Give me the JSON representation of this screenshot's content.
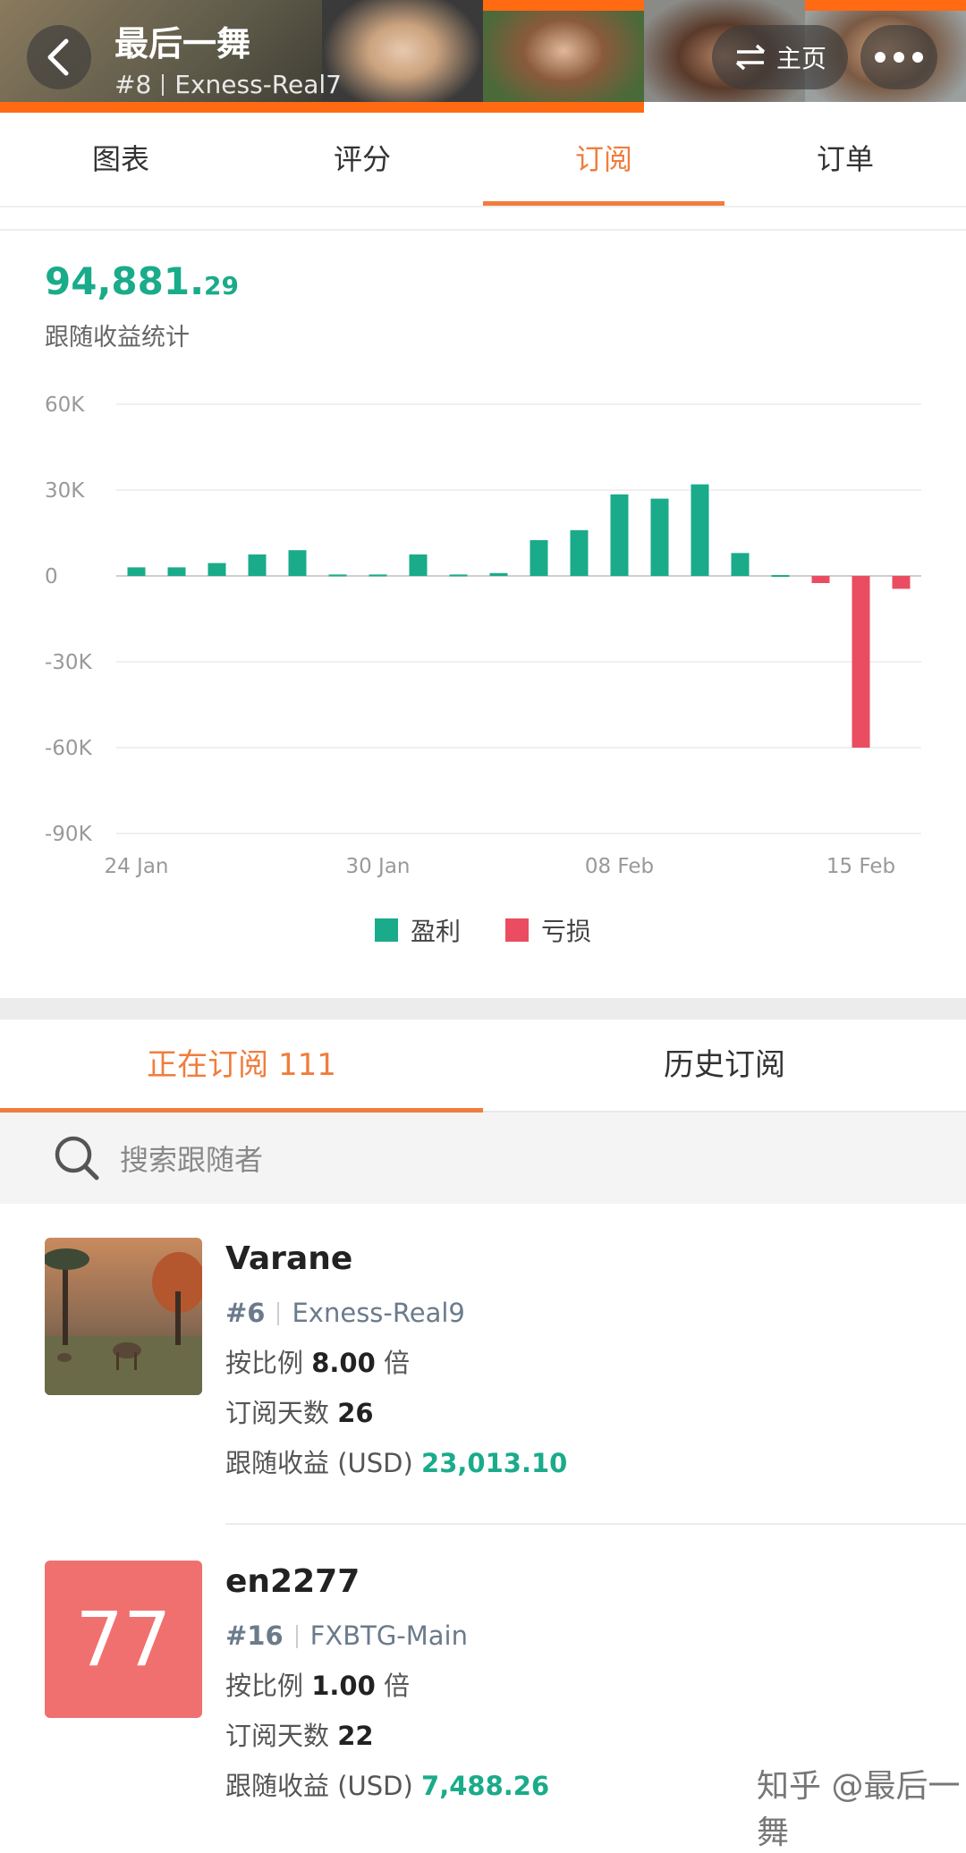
{
  "header": {
    "title": "最后一舞",
    "rank": "#8",
    "server": "Exness-Real7",
    "home_label": "主页"
  },
  "top_tabs": [
    {
      "label": "图表",
      "active": false
    },
    {
      "label": "评分",
      "active": false
    },
    {
      "label": "订阅",
      "active": true
    },
    {
      "label": "订单",
      "active": false
    }
  ],
  "stats": {
    "profit_main": "94,881.",
    "profit_decimal": "29",
    "profit_label": "跟随收益统计"
  },
  "chart_data": {
    "type": "bar",
    "y_ticks": [
      "60K",
      "30K",
      "0",
      "-30K",
      "-60K",
      "-90K"
    ],
    "ylim": [
      -90000,
      60000
    ],
    "x_tick_labels": [
      {
        "label": "24 Jan",
        "index": 0
      },
      {
        "label": "30 Jan",
        "index": 6
      },
      {
        "label": "08 Feb",
        "index": 12
      },
      {
        "label": "15 Feb",
        "index": 18
      }
    ],
    "categories": [
      "24 Jan",
      "25 Jan",
      "26 Jan",
      "27 Jan",
      "28 Jan",
      "29 Jan",
      "30 Jan",
      "31 Jan",
      "01 Feb",
      "02 Feb",
      "06 Feb",
      "07 Feb",
      "08 Feb",
      "09 Feb",
      "10 Feb",
      "11 Feb",
      "12 Feb",
      "14 Feb",
      "15 Feb",
      "16 Feb"
    ],
    "values": [
      3000,
      3000,
      4500,
      7500,
      9000,
      500,
      500,
      7500,
      500,
      1000,
      12500,
      16000,
      28500,
      27000,
      32000,
      8000,
      300,
      -2500,
      -60000,
      -4500
    ],
    "legend": [
      {
        "label": "盈利",
        "color": "#1aab8a"
      },
      {
        "label": "亏损",
        "color": "#ea4d61"
      }
    ]
  },
  "sub_tabs": [
    {
      "label": "正在订阅 111",
      "active": true
    },
    {
      "label": "历史订阅",
      "active": false
    }
  ],
  "search": {
    "placeholder": "搜索跟随者"
  },
  "subscribers": [
    {
      "name": "Varane",
      "rank": "#6",
      "server": "Exness-Real9",
      "ratio_label": "按比例",
      "ratio": "8.00",
      "ratio_unit": "倍",
      "days_label": "订阅天数",
      "days": "26",
      "profit_label": "跟随收益 (USD)",
      "profit": "23,013.10"
    },
    {
      "name": "en2277",
      "avatar_text": "77",
      "rank": "#16",
      "server": "FXBTG-Main",
      "ratio_label": "按比例",
      "ratio": "1.00",
      "ratio_unit": "倍",
      "days_label": "订阅天数",
      "days": "22",
      "profit_label": "跟随收益 (USD)",
      "profit": "7,488.26"
    }
  ],
  "watermark": "知乎 @最后一舞"
}
